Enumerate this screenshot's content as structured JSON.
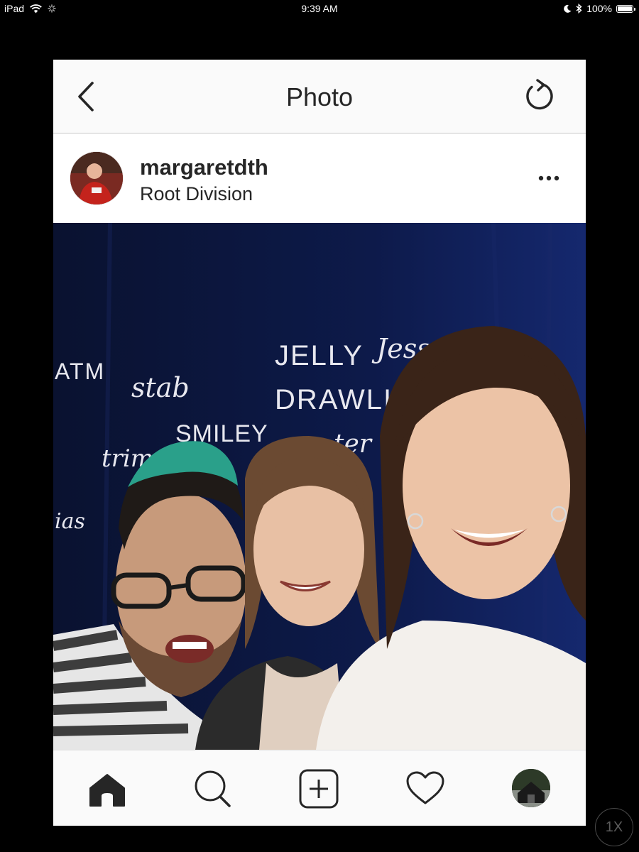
{
  "status_bar": {
    "device": "iPad",
    "time": "9:39 AM",
    "battery": "100%"
  },
  "nav": {
    "title": "Photo",
    "back_icon": "chevron-left-icon",
    "refresh_icon": "refresh-icon"
  },
  "post": {
    "username": "margaretdth",
    "location": "Root Division",
    "more_icon": "ellipsis-icon"
  },
  "photo": {
    "embroidered_words": [
      "ATM",
      "stab",
      "JELLY",
      "Jess",
      "DRAWLI",
      "SMILEY",
      "trim",
      "ter",
      "ias"
    ]
  },
  "tab_bar": {
    "items": [
      "home-icon",
      "search-icon",
      "add-post-icon",
      "heart-icon",
      "profile-avatar"
    ],
    "active": "home-icon"
  },
  "scale_button": {
    "label": "1X"
  },
  "colors": {
    "background": "#000000",
    "text": "#262626",
    "bar": "#fafafa",
    "backdrop": "#0c1433"
  }
}
